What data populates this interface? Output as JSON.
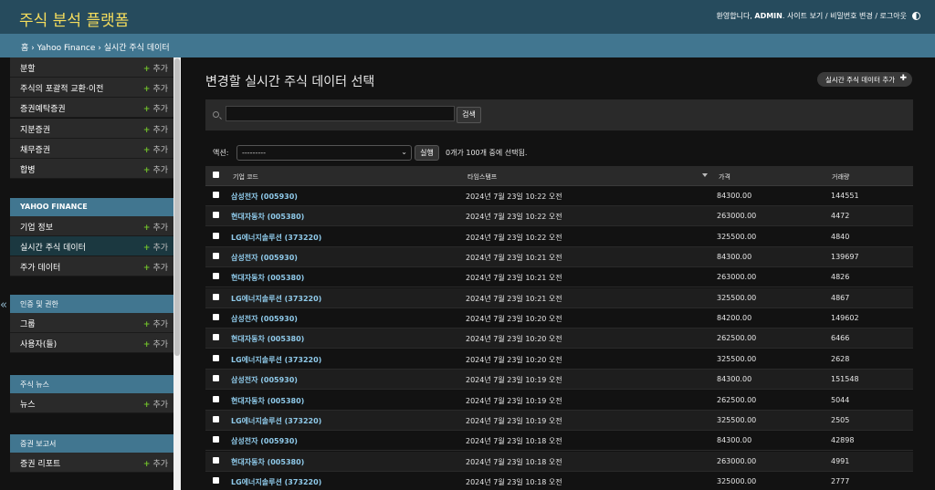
{
  "header": {
    "site_title": "주식 분석 플랫폼",
    "welcome": "환영합니다,",
    "username": "ADMIN",
    "links": ". 사이트 보기 / 비밀번호 변경 / 로그아웃"
  },
  "breadcrumbs": "홈 › Yahoo Finance › 실시간 주식 데이터",
  "sidebar": {
    "add_label": "추가",
    "collapse_glyph": "«",
    "top_items": [
      "분할",
      "주식의 포괄적 교환·이전",
      "증권예탁증권",
      "지분증권",
      "채무증권",
      "합병"
    ],
    "sections": [
      {
        "caption": "YAHOO FINANCE",
        "items": [
          "기업 정보",
          "실시간 주식 데이터",
          "주가 데이터"
        ]
      },
      {
        "caption": "인증 및 권한",
        "items": [
          "그룹",
          "사용자(들)"
        ]
      },
      {
        "caption": "주식 뉴스",
        "items": [
          "뉴스"
        ]
      },
      {
        "caption": "증권 보고서",
        "items": [
          "증권 리포트"
        ]
      }
    ]
  },
  "main": {
    "title": "변경할 실시간 주식 데이터 선택",
    "add_button": "실시간 주식 데이터 추가",
    "search": {
      "button": "검색",
      "value": ""
    },
    "actions": {
      "label": "액션:",
      "selected": "---------",
      "go": "실행",
      "counter": "0개가 100개 중에 선택됨."
    },
    "columns": [
      "기업 코드",
      "타임스탬프",
      "가격",
      "거래량"
    ],
    "rows": [
      {
        "company": "삼성전자 (005930)",
        "timestamp": "2024년 7월 23일 10:22 오전",
        "price": "84300.00",
        "volume": "144551"
      },
      {
        "company": "현대자동차 (005380)",
        "timestamp": "2024년 7월 23일 10:22 오전",
        "price": "263000.00",
        "volume": "4472"
      },
      {
        "company": "LG에너지솔루션 (373220)",
        "timestamp": "2024년 7월 23일 10:22 오전",
        "price": "325500.00",
        "volume": "4840"
      },
      {
        "company": "삼성전자 (005930)",
        "timestamp": "2024년 7월 23일 10:21 오전",
        "price": "84300.00",
        "volume": "139697"
      },
      {
        "company": "현대자동차 (005380)",
        "timestamp": "2024년 7월 23일 10:21 오전",
        "price": "263000.00",
        "volume": "4826"
      },
      {
        "company": "LG에너지솔루션 (373220)",
        "timestamp": "2024년 7월 23일 10:21 오전",
        "price": "325500.00",
        "volume": "4867"
      },
      {
        "company": "삼성전자 (005930)",
        "timestamp": "2024년 7월 23일 10:20 오전",
        "price": "84200.00",
        "volume": "149602"
      },
      {
        "company": "현대자동차 (005380)",
        "timestamp": "2024년 7월 23일 10:20 오전",
        "price": "262500.00",
        "volume": "6466"
      },
      {
        "company": "LG에너지솔루션 (373220)",
        "timestamp": "2024년 7월 23일 10:20 오전",
        "price": "325500.00",
        "volume": "2628"
      },
      {
        "company": "삼성전자 (005930)",
        "timestamp": "2024년 7월 23일 10:19 오전",
        "price": "84300.00",
        "volume": "151548"
      },
      {
        "company": "현대자동차 (005380)",
        "timestamp": "2024년 7월 23일 10:19 오전",
        "price": "262500.00",
        "volume": "5044"
      },
      {
        "company": "LG에너지솔루션 (373220)",
        "timestamp": "2024년 7월 23일 10:19 오전",
        "price": "325500.00",
        "volume": "2505"
      },
      {
        "company": "삼성전자 (005930)",
        "timestamp": "2024년 7월 23일 10:18 오전",
        "price": "84300.00",
        "volume": "42898"
      },
      {
        "company": "현대자동차 (005380)",
        "timestamp": "2024년 7월 23일 10:18 오전",
        "price": "263000.00",
        "volume": "4991"
      },
      {
        "company": "LG에너지솔루션 (373220)",
        "timestamp": "2024년 7월 23일 10:18 오전",
        "price": "325000.00",
        "volume": "2777"
      }
    ]
  },
  "colors": {
    "header_bg": "#264b5d",
    "site_title": "#f5dd5d",
    "breadcrumb_bg": "#417690",
    "add_plus": "#70bf2b",
    "link": "#8fcaea"
  },
  "icons": {
    "theme": "theme-toggle-icon",
    "search": "search-icon",
    "add": "plus-icon",
    "sort": "sort-desc-icon"
  }
}
